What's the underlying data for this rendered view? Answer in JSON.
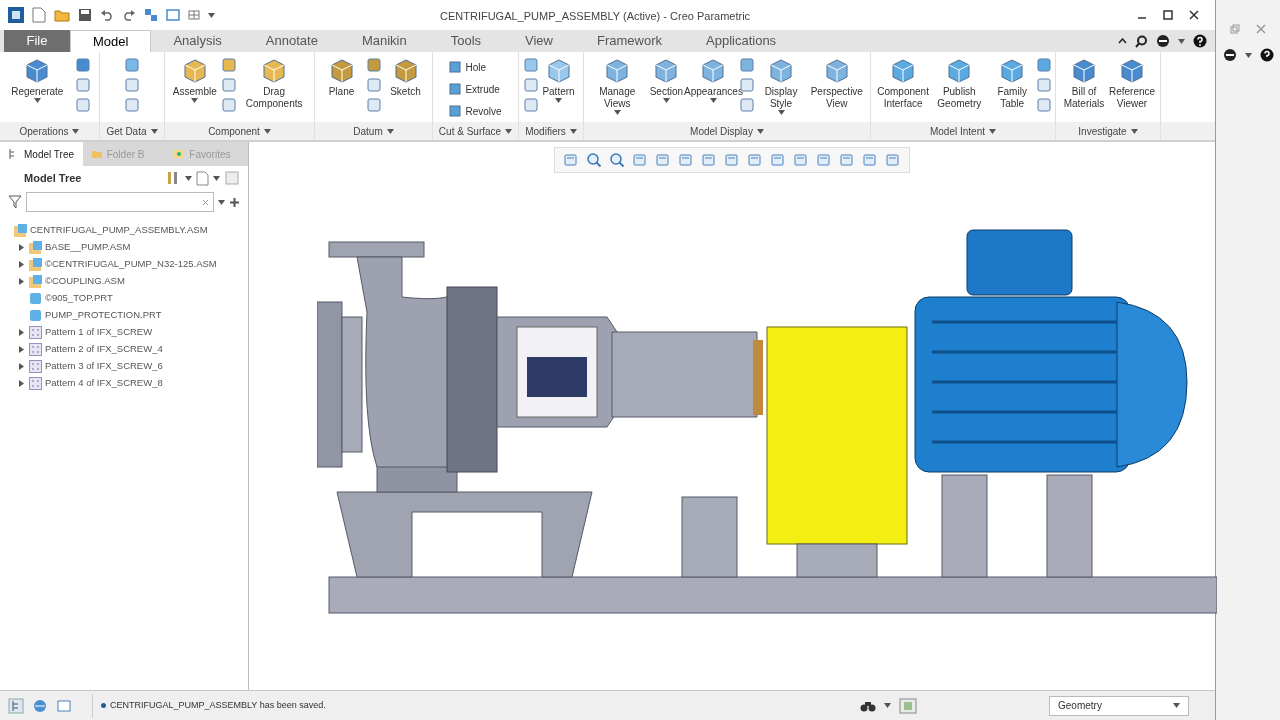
{
  "window": {
    "title": "CENTRIFUGAL_PUMP_ASSEMBLY (Active) - Creo Parametric"
  },
  "tabs": [
    {
      "label": "File",
      "kind": "file",
      "selected": false
    },
    {
      "label": "Model",
      "kind": "tab",
      "selected": true
    },
    {
      "label": "Analysis",
      "kind": "tab",
      "selected": false
    },
    {
      "label": "Annotate",
      "kind": "tab",
      "selected": false
    },
    {
      "label": "Manikin",
      "kind": "tab",
      "selected": false
    },
    {
      "label": "Tools",
      "kind": "tab",
      "selected": false
    },
    {
      "label": "View",
      "kind": "tab",
      "selected": false
    },
    {
      "label": "Framework",
      "kind": "tab",
      "selected": false
    },
    {
      "label": "Applications",
      "kind": "tab",
      "selected": false
    }
  ],
  "ribbon": {
    "groups": [
      {
        "label": "Operations",
        "tools": [
          {
            "kind": "large",
            "label": "Regenerate",
            "has_menu": true
          },
          {
            "kind": "icons"
          }
        ]
      },
      {
        "label": "Get Data",
        "tools": [
          {
            "kind": "icons"
          }
        ]
      },
      {
        "label": "Component",
        "tools": [
          {
            "kind": "large",
            "label": "Assemble",
            "has_menu": true
          },
          {
            "kind": "icons"
          },
          {
            "kind": "large",
            "label": "Drag Components",
            "has_menu": false
          }
        ]
      },
      {
        "label": "Datum",
        "tools": [
          {
            "kind": "large",
            "label": "Plane",
            "has_menu": false
          },
          {
            "kind": "icons"
          },
          {
            "kind": "large",
            "label": "Sketch",
            "has_menu": false
          }
        ]
      },
      {
        "label": "Cut & Surface",
        "tools": [
          {
            "kind": "small",
            "label": "Hole"
          },
          {
            "kind": "small",
            "label": "Extrude"
          },
          {
            "kind": "small",
            "label": "Revolve"
          }
        ]
      },
      {
        "label": "Modifiers",
        "tools": [
          {
            "kind": "icons"
          },
          {
            "kind": "large",
            "label": "Pattern",
            "has_menu": true
          }
        ]
      },
      {
        "label": "Model Display",
        "tools": [
          {
            "kind": "large",
            "label": "Manage Views",
            "has_menu": true
          },
          {
            "kind": "large",
            "label": "Section",
            "has_menu": true
          },
          {
            "kind": "large",
            "label": "Appearances",
            "has_menu": true
          },
          {
            "kind": "icons"
          },
          {
            "kind": "large",
            "label": "Display Style",
            "has_menu": true
          },
          {
            "kind": "large",
            "label": "Perspective View",
            "has_menu": false
          }
        ]
      },
      {
        "label": "Model Intent",
        "tools": [
          {
            "kind": "large",
            "label": "Component Interface",
            "has_menu": false
          },
          {
            "kind": "large",
            "label": "Publish Geometry",
            "has_menu": false
          },
          {
            "kind": "large",
            "label": "Family Table",
            "has_menu": false
          },
          {
            "kind": "icons"
          }
        ]
      },
      {
        "label": "Investigate",
        "tools": [
          {
            "kind": "large",
            "label": "Bill of Materials",
            "has_menu": false
          },
          {
            "kind": "large",
            "label": "Reference Viewer",
            "has_menu": false
          }
        ]
      }
    ]
  },
  "navigator": {
    "tabs": [
      {
        "label": "Model Tree",
        "selected": true
      },
      {
        "label": "Folder B",
        "selected": false
      },
      {
        "label": "Favorites",
        "selected": false
      }
    ],
    "header": "Model Tree",
    "tree": [
      {
        "label": "CENTRIFUGAL_PUMP_ASSEMBLY.ASM",
        "kind": "assembly",
        "children": [
          {
            "label": "BASE__PUMP.ASM",
            "kind": "assembly",
            "collapsed": true
          },
          {
            "label": "©CENTRIFUGAL_PUMP_N32-125.ASM",
            "kind": "assembly",
            "collapsed": true
          },
          {
            "label": "©COUPLING.ASM",
            "kind": "assembly",
            "collapsed": true
          },
          {
            "label": "©905_TOP.PRT",
            "kind": "part",
            "collapsed": false
          },
          {
            "label": "PUMP_PROTECTION.PRT",
            "kind": "part",
            "collapsed": false
          },
          {
            "label": "Pattern 1 of IFX_SCREW",
            "kind": "pattern",
            "collapsed": true
          },
          {
            "label": "Pattern 2 of IFX_SCREW_4",
            "kind": "pattern",
            "collapsed": true
          },
          {
            "label": "Pattern 3 of IFX_SCREW_6",
            "kind": "pattern",
            "collapsed": true
          },
          {
            "label": "Pattern 4 of IFX_SCREW_8",
            "kind": "pattern",
            "collapsed": true
          }
        ]
      }
    ]
  },
  "status_bar": {
    "message": "CENTRIFUGAL_PUMP_ASSEMBLY has been saved.",
    "filter": "Geometry"
  }
}
